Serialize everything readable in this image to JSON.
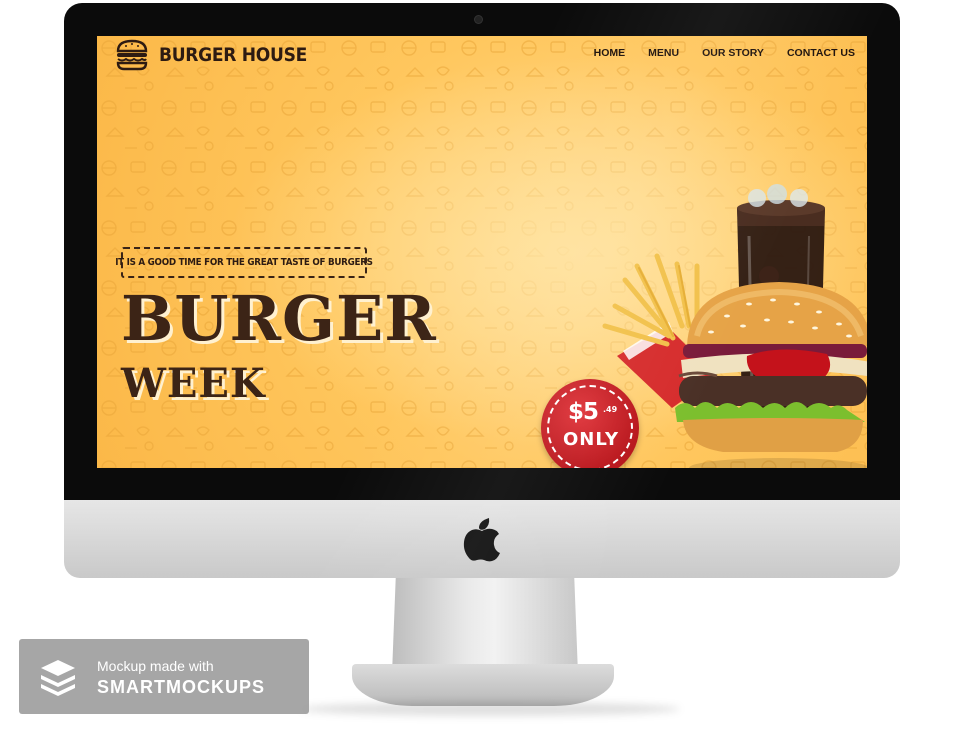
{
  "site": {
    "brand": "BURGER HOUSE",
    "nav": [
      "HOME",
      "MENU",
      "OUR STORY",
      "CONTACT US"
    ]
  },
  "hero": {
    "tagline": "IT IS A GOOD TIME FOR THE GREAT TASTE OF BURGERS",
    "headline": "BURGER",
    "subheadline": "WEEK",
    "price": {
      "amount": "$5",
      "cents": ".49",
      "suffix": "ONLY"
    }
  },
  "watermark": {
    "line1": "Mockup made with",
    "line2": "SMARTMOCKUPS"
  },
  "colors": {
    "background": "#fbb848",
    "text_dark": "#3c2416",
    "badge_red": "#c81d24"
  },
  "icons": [
    "burger-logo-icon",
    "apple-logo-icon",
    "smartmockups-icon"
  ]
}
